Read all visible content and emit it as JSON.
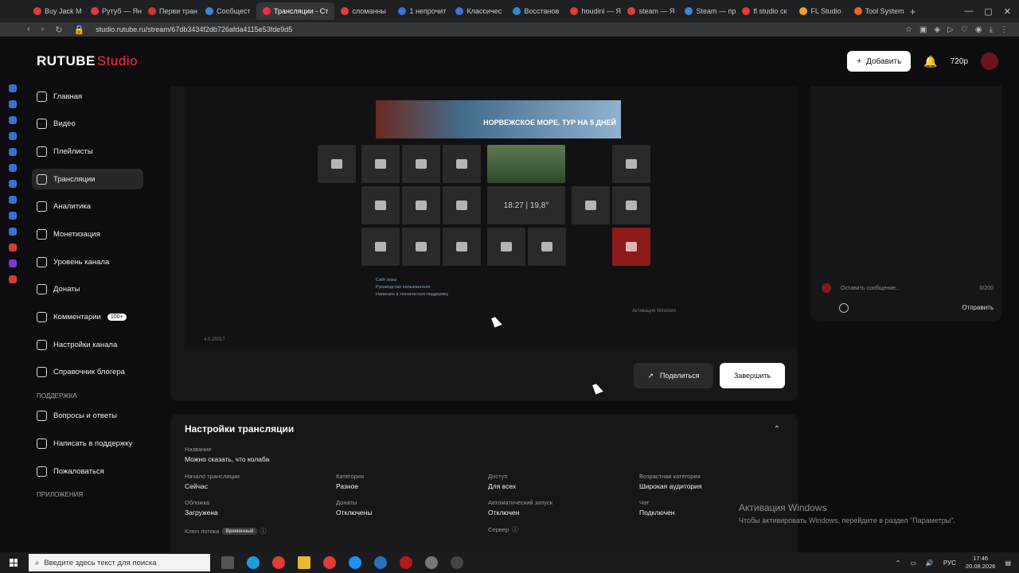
{
  "browser": {
    "tabs": [
      {
        "label": "Buy Jack M",
        "color": "#e23b3b"
      },
      {
        "label": "Рутуб — Ян",
        "color": "#e33b36"
      },
      {
        "label": "Перви тран",
        "color": "#d93232"
      },
      {
        "label": "Сообщест",
        "color": "#3a86d8"
      },
      {
        "label": "Трансляции - Ст",
        "color": "#ff2b3f"
      },
      {
        "label": "сломанны",
        "color": "#e33b36"
      },
      {
        "label": "1 непрочит",
        "color": "#3b72d8"
      },
      {
        "label": "Классичес",
        "color": "#3b72d8"
      },
      {
        "label": "Восстанов",
        "color": "#2f8ccf"
      },
      {
        "label": "houdini — Я",
        "color": "#e33b36"
      },
      {
        "label": "steam — Я",
        "color": "#e33b36"
      },
      {
        "label": "Steam — пр",
        "color": "#3a86d8"
      },
      {
        "label": "fl studio ск",
        "color": "#e33b36"
      },
      {
        "label": "FL Studio",
        "color": "#f0a020"
      },
      {
        "label": "Tool System",
        "color": "#e86a1c"
      }
    ],
    "active_tab_index": 4,
    "new_tab": "+",
    "url": "studio.rutube.ru/stream/67db3434f2db726afda4115e53fde9d5"
  },
  "header": {
    "logo": "RUTUBE",
    "logo_suffix": "Studio",
    "add_button": "Добавить",
    "quality": "720p"
  },
  "sidebar": {
    "items": [
      {
        "label": "Главная",
        "icon": "home-icon"
      },
      {
        "label": "Видео",
        "icon": "video-icon"
      },
      {
        "label": "Плейлисты",
        "icon": "playlist-icon"
      },
      {
        "label": "Трансляции",
        "icon": "broadcast-icon",
        "active": true
      },
      {
        "label": "Аналитика",
        "icon": "analytics-icon"
      },
      {
        "label": "Монетизация",
        "icon": "money-icon"
      },
      {
        "label": "Уровень канала",
        "icon": "level-icon"
      },
      {
        "label": "Донаты",
        "icon": "donate-icon"
      },
      {
        "label": "Комментарии",
        "icon": "comments-icon",
        "badge": "100+"
      },
      {
        "label": "Настройки канала",
        "icon": "settings-icon"
      },
      {
        "label": "Справочник блогера",
        "icon": "book-icon"
      }
    ],
    "support_title": "ПОДДЕРЖКА",
    "support_items": [
      {
        "label": "Вопросы и ответы",
        "icon": "help-icon"
      },
      {
        "label": "Написать в поддержку",
        "icon": "mail-icon"
      },
      {
        "label": "Пожаловаться",
        "icon": "flag-icon"
      }
    ],
    "apps_title": "ПРИЛОЖЕНИЯ"
  },
  "player": {
    "promo_text": "НОРВЕЖСКОЕ МОРЕ. ТУР НА 5 ДНЕЙ",
    "weather": "18:27 | 19,8°",
    "version": "4.0.25017",
    "links": [
      "Сайт игры",
      "Руководство пользователя",
      "Написать в техническую поддержку"
    ],
    "win_activation_small": "Активация Windows",
    "share_button": "Поделиться",
    "end_button": "Завершить"
  },
  "chat": {
    "placeholder": "Оставить сообщение...",
    "counter": "0/200",
    "send": "Отправить"
  },
  "settings": {
    "title": "Настройки трансляции",
    "name_label": "Название",
    "name_value": "Можно сказать, что колаба",
    "fields": [
      {
        "label": "Начало трансляции",
        "value": "Сейчас"
      },
      {
        "label": "Категория",
        "value": "Разное"
      },
      {
        "label": "Доступ",
        "value": "Для всех"
      },
      {
        "label": "Возрастная категория",
        "value": "Широкая аудитория"
      },
      {
        "label": "Обложка",
        "value": "Загружена"
      },
      {
        "label": "Донаты",
        "value": "Отключены"
      },
      {
        "label": "Автоматический запуск",
        "value": "Отключен"
      },
      {
        "label": "Чат",
        "value": "Подключен"
      }
    ],
    "stream_key_label": "Ключ потока",
    "stream_key_badge": "Временный",
    "server_label": "Сервер"
  },
  "windows": {
    "activation_title": "Активация Windows",
    "activation_text": "Чтобы активировать Windows, перейдите в раздел \"Параметры\".",
    "search_placeholder": "Введите здесь текст для поиска",
    "lang": "РУС",
    "time": "17:46",
    "date": "20.08.2026"
  }
}
